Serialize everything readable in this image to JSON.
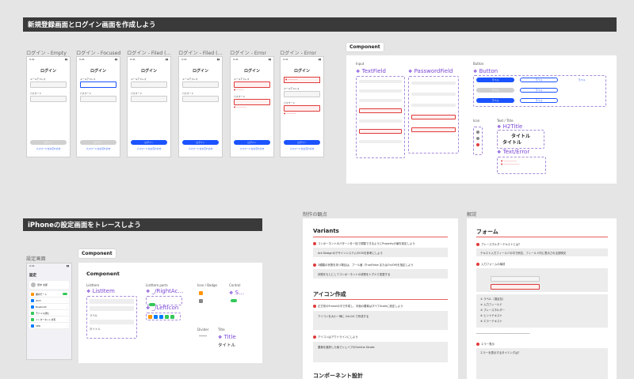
{
  "section1": {
    "banner": "新規登録画面とログイン画面を作成しよう",
    "frames": [
      {
        "label": "ログイン - Empty",
        "title": "ログイン",
        "email_label": "メールアドレス",
        "password_label": "パスワード",
        "button": "ログイン",
        "link": "パスワードをお忘れの方",
        "state": "empty"
      },
      {
        "label": "ログイン - Focused",
        "title": "ログイン",
        "email_label": "メールアドレス",
        "password_label": "パスワード",
        "button": "ログイン",
        "link": "パスワードをお忘れの方",
        "state": "focused"
      },
      {
        "label": "ログイン - Filed (…",
        "title": "ログイン",
        "email_label": "メールアドレス",
        "password_label": "パスワード",
        "button": "ログイン",
        "link": "パスワードをお忘れの方",
        "state": "filled"
      },
      {
        "label": "ログイン - Filed (…",
        "title": "ログイン",
        "email_label": "メールアドレス",
        "password_label": "パスワード",
        "button": "ログイン",
        "link": "パスワードをお忘れの方",
        "state": "filled"
      },
      {
        "label": "ログイン - Error",
        "title": "ログイン",
        "email_label": "メールアドレス",
        "password_label": "パスワード",
        "button": "ログイン",
        "link": "パスワードをお忘れの方",
        "state": "error"
      },
      {
        "label": "ログイン - Error",
        "title": "ログイン",
        "email_label": "メールアドレス",
        "password_label": "パスワード",
        "button": "ログイン",
        "link": "パスワードをお忘れの方",
        "state": "error2"
      }
    ],
    "status_time": "9:41"
  },
  "component_panel1": {
    "tag": "Component",
    "input_label": "Input",
    "textfield": "TextField",
    "passwordfield": "PasswordField",
    "button_label": "Button",
    "button_title": "Button",
    "icon_label": "Icon",
    "text_title_label": "Text / Title",
    "h2title": "H2Title",
    "h2_sample": "タイトル",
    "h2_sample2": "タイトル",
    "text_error": "Text/Error",
    "btn_sample": "ラベル"
  },
  "section2": {
    "banner": "iPhoneの設定画面をトレースしよう",
    "frame_label": "設定画面",
    "settings_title": "設定",
    "user_name": "田中 太郎",
    "items": [
      "機内モード",
      "Wi-Fi",
      "Bluetooth",
      "モバイル通信",
      "インターネット共有",
      "VPN"
    ]
  },
  "component_panel2": {
    "tag": "Component",
    "heading": "Component",
    "listitem_label": "ListItem",
    "listitem": "ListItem",
    "listitem_parts_label": "ListItem parts",
    "rightac": "_/RightAc…",
    "lefticon": "_/LeftIcon",
    "icon_badge_label": "Icon / Badge",
    "control_label": "Control",
    "control_title": "S…",
    "divider_label": "Divider",
    "title_label": "Title",
    "title_comp": "Title",
    "title_sample": "タイトル",
    "list_sample": "ラベル",
    "list_sample2": "タイトル"
  },
  "doc1": {
    "label": "制作の観点",
    "h_variants": "Variants",
    "q1": "コンポーネントのパターンを一括で調整できるようにPropertyの値を設定しよう",
    "a1": "Ant DesignのデザインシステムやiOSを参考にしよう",
    "q2": "2種類の状態を持つ場合は、ブール値（True/False またはOn/Off)を指定しよう",
    "a2": "状態をもとにしてコンポーネントの状態をトグルで変更する",
    "h_icon": "アイコン作成",
    "q3": "正方形のFrameの中で作成し、半面の要素はすべてScaleに設定しよう",
    "a3": "アイコンを大小一律に 24×24 で作成する",
    "q4": "アイコンはアウトラインにしよう",
    "a4": "要素を選択した後でシェイプのOutline Stroke",
    "h_comp": "コンポーネント設計"
  },
  "doc2": {
    "label": "解説",
    "h_form": "フォーム",
    "q1": "プレースホルダーテキストとは？",
    "a1": "テキスト入力フィールドの中で例文、フィールド内に表示される説明文",
    "q2": "入力フォームの構成",
    "list": [
      "① ラベル（項目名）",
      "② 入力フィールド",
      "③ プレースホルダー",
      "④ ヒントテキスト",
      "⑤ エラーテキスト"
    ],
    "q3": "エラー表示",
    "a3": "エラーを表示するタイミングは？"
  }
}
